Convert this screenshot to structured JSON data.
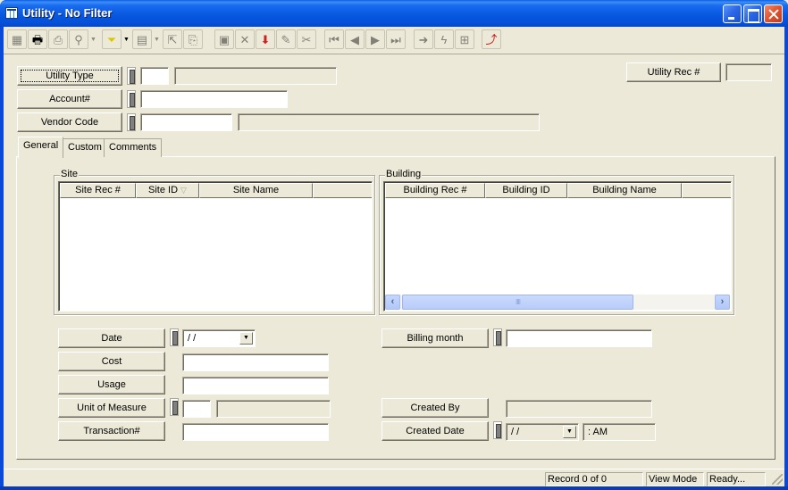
{
  "window": {
    "title": "Utility - No Filter",
    "controls": [
      "minimize",
      "maximize",
      "close"
    ]
  },
  "toolbar": {
    "buttons": [
      {
        "name": "select-all",
        "icon": "select-icon",
        "glyph": "▦",
        "enabled": false
      },
      {
        "name": "print",
        "icon": "printer-icon",
        "glyph": "🖶",
        "enabled": true
      },
      {
        "name": "preview",
        "icon": "preview-icon",
        "glyph": "⎙",
        "enabled": false
      },
      {
        "name": "find",
        "icon": "binoculars-icon",
        "glyph": "⚲",
        "enabled": false,
        "dropdown": true
      },
      {
        "name": "filter",
        "icon": "filter-funnel-icon",
        "glyph": "⏷",
        "enabled": true,
        "dropdown": true
      },
      {
        "name": "report",
        "icon": "report-icon",
        "glyph": "▤",
        "enabled": false,
        "dropdown": true
      },
      {
        "name": "export",
        "icon": "export-icon",
        "glyph": "⇱",
        "enabled": false
      },
      {
        "name": "attach",
        "icon": "attach-icon",
        "glyph": "⎘",
        "enabled": false
      },
      {
        "name": "save",
        "icon": "save-icon",
        "glyph": "▣",
        "enabled": false
      },
      {
        "name": "delete",
        "icon": "delete-x-icon",
        "glyph": "✕",
        "enabled": false
      },
      {
        "name": "new",
        "icon": "new-record-icon",
        "glyph": "⬇",
        "enabled": true
      },
      {
        "name": "edit",
        "icon": "pencil-icon",
        "glyph": "✎",
        "enabled": false
      },
      {
        "name": "cut",
        "icon": "scissors-icon",
        "glyph": "✂",
        "enabled": false
      },
      {
        "name": "first",
        "icon": "first-record-icon",
        "glyph": "⏮",
        "enabled": false
      },
      {
        "name": "previous",
        "icon": "previous-record-icon",
        "glyph": "◀",
        "enabled": false
      },
      {
        "name": "next",
        "icon": "next-record-icon",
        "glyph": "▶",
        "enabled": false
      },
      {
        "name": "last",
        "icon": "last-record-icon",
        "glyph": "⏭",
        "enabled": false
      },
      {
        "name": "go",
        "icon": "arrow-right-icon",
        "glyph": "➜",
        "enabled": false
      },
      {
        "name": "lightning",
        "icon": "lightning-icon",
        "glyph": "ϟ",
        "enabled": false
      },
      {
        "name": "tree",
        "icon": "tree-icon",
        "glyph": "⊞",
        "enabled": false
      },
      {
        "name": "exit",
        "icon": "exit-icon",
        "glyph": "⤴",
        "enabled": true
      }
    ]
  },
  "header": {
    "utility_type": {
      "label": "Utility Type",
      "code": "",
      "description": ""
    },
    "account": {
      "label": "Account#",
      "value": ""
    },
    "vendor_code": {
      "label": "Vendor Code",
      "code": "",
      "description": ""
    },
    "utility_rec": {
      "label": "Utility Rec #",
      "value": ""
    }
  },
  "tabs": [
    {
      "label": "General",
      "active": true
    },
    {
      "label": "Custom",
      "active": false
    },
    {
      "label": "Comments",
      "active": false
    }
  ],
  "general": {
    "site": {
      "label": "Site",
      "columns": [
        "Site Rec #",
        "Site ID",
        "Site Name",
        ""
      ],
      "sorted_column": "Site ID",
      "rows": []
    },
    "building": {
      "label": "Building",
      "columns": [
        "Building Rec #",
        "Building ID",
        "Building Name",
        ""
      ],
      "rows": [],
      "scroll_thumb_glyph": "IIII"
    },
    "fields": {
      "date": {
        "label": "Date",
        "value": " /  /"
      },
      "cost": {
        "label": "Cost",
        "value": ""
      },
      "usage": {
        "label": "Usage",
        "value": ""
      },
      "unit_of_measure": {
        "label": "Unit of Measure",
        "code": "",
        "description": ""
      },
      "transaction": {
        "label": "Transaction#",
        "value": ""
      },
      "billing_month": {
        "label": "Billing month",
        "value": ""
      },
      "created_by": {
        "label": "Created By",
        "value": ""
      },
      "created_date": {
        "label": "Created Date",
        "date": " /  /",
        "time": " :  AM"
      }
    }
  },
  "status_bar": {
    "record": "Record 0 of 0",
    "mode": "View Mode",
    "status": "Ready..."
  }
}
